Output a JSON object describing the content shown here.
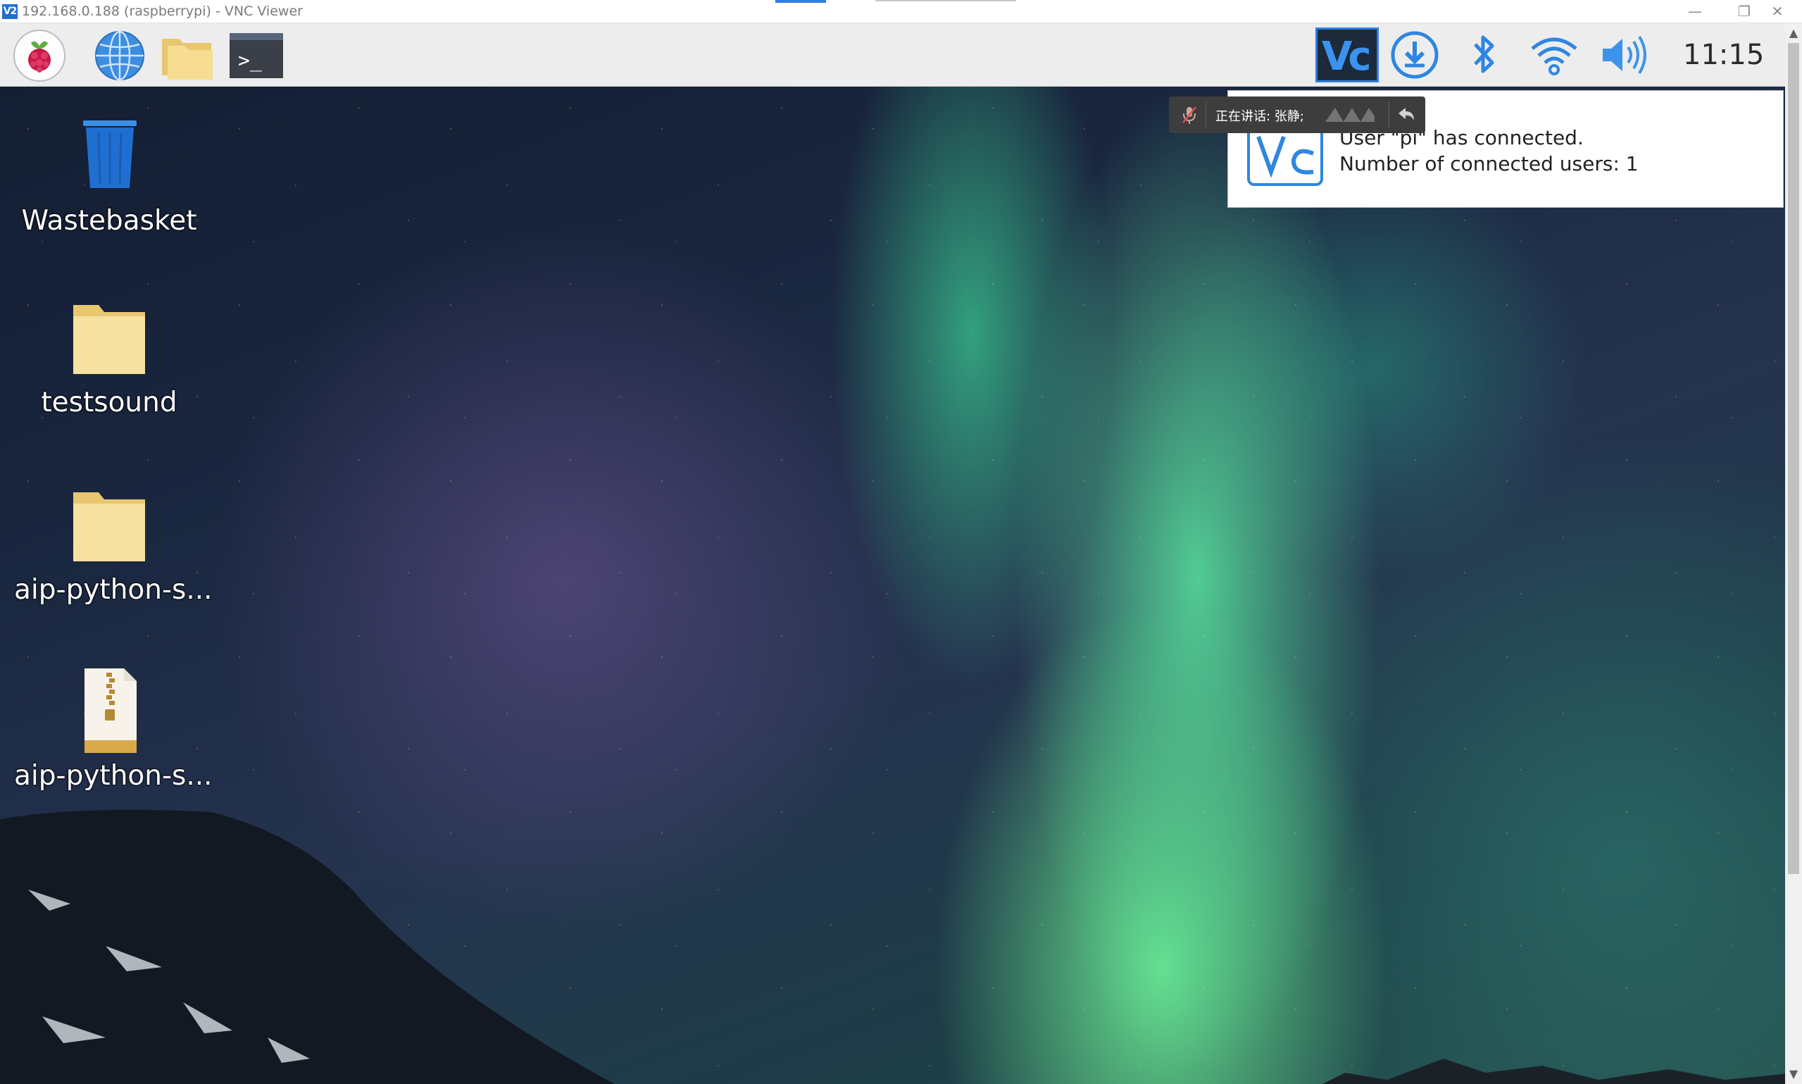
{
  "window": {
    "title": "192.168.0.188 (raspberrypi) - VNC Viewer",
    "app_icon_text": "V2",
    "min_glyph": "—",
    "restore_glyph": "❐",
    "close_glyph": "✕"
  },
  "panel": {
    "launchers": [
      {
        "name": "raspberry-menu-icon"
      },
      {
        "name": "web-browser-icon"
      },
      {
        "name": "file-manager-icon"
      },
      {
        "name": "terminal-icon"
      }
    ],
    "terminal_prompt": ">_",
    "tray": {
      "vnc_label": "Vc",
      "clock": "11:15"
    }
  },
  "desktop": {
    "icons": [
      {
        "label": "Wastebasket",
        "type": "trash"
      },
      {
        "label": "testsound",
        "type": "folder"
      },
      {
        "label": "aip-python-s...",
        "type": "folder"
      },
      {
        "label": "aip-python-s...",
        "type": "zip"
      }
    ]
  },
  "notification": {
    "line1": "User \"pi\" has connected.",
    "line2": "Number of connected users: 1"
  },
  "speaking_bar": {
    "text": "正在讲话: 张静;"
  },
  "colors": {
    "vnc_blue": "#2f7de1",
    "panel_bg": "#ededed",
    "folder_yellow": "#f5dc8c",
    "trash_blue": "#1f6fd1"
  }
}
